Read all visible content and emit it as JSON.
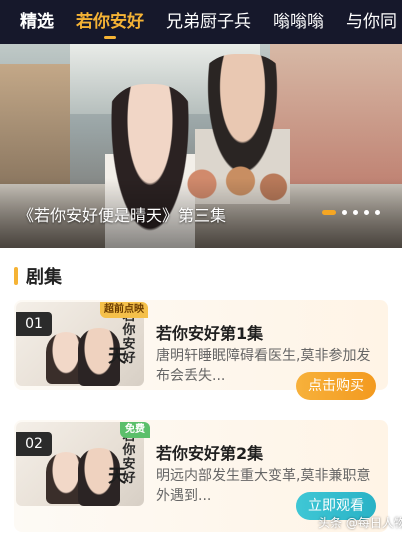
{
  "tabs": [
    {
      "label": "精选"
    },
    {
      "label": "若你安好"
    },
    {
      "label": "兄弟厨子兵"
    },
    {
      "label": "嗡嗡嗡"
    },
    {
      "label": "与你同"
    }
  ],
  "active_tab_index": 1,
  "banner": {
    "caption": "《若你安好便是晴天》第三集",
    "dot_count": 5,
    "active_dot": 0
  },
  "section": {
    "title": "剧集"
  },
  "episodes": [
    {
      "number": "01",
      "badge": "超前点映",
      "title": "若你安好第1集",
      "description": "唐明轩睡眠障碍看医生,莫非参加发布会丢失...",
      "button": "点击购买",
      "thumb_text": "若你安好",
      "thumb_text2": "天"
    },
    {
      "number": "02",
      "badge": "免费",
      "title": "若你安好第2集",
      "description": "明远内部发生重大变革,莫非兼职意外遇到...",
      "button": "立即观看",
      "thumb_text": "若你安好",
      "thumb_text2": "天"
    }
  ],
  "watermark": "头条 @每日人物",
  "colors": {
    "tab_active": "#f5b335",
    "tabbar_bg": "#16182b",
    "buy_button": "#f5a623",
    "watch_button": "#35bccd",
    "free_badge": "#5bbf6a"
  }
}
